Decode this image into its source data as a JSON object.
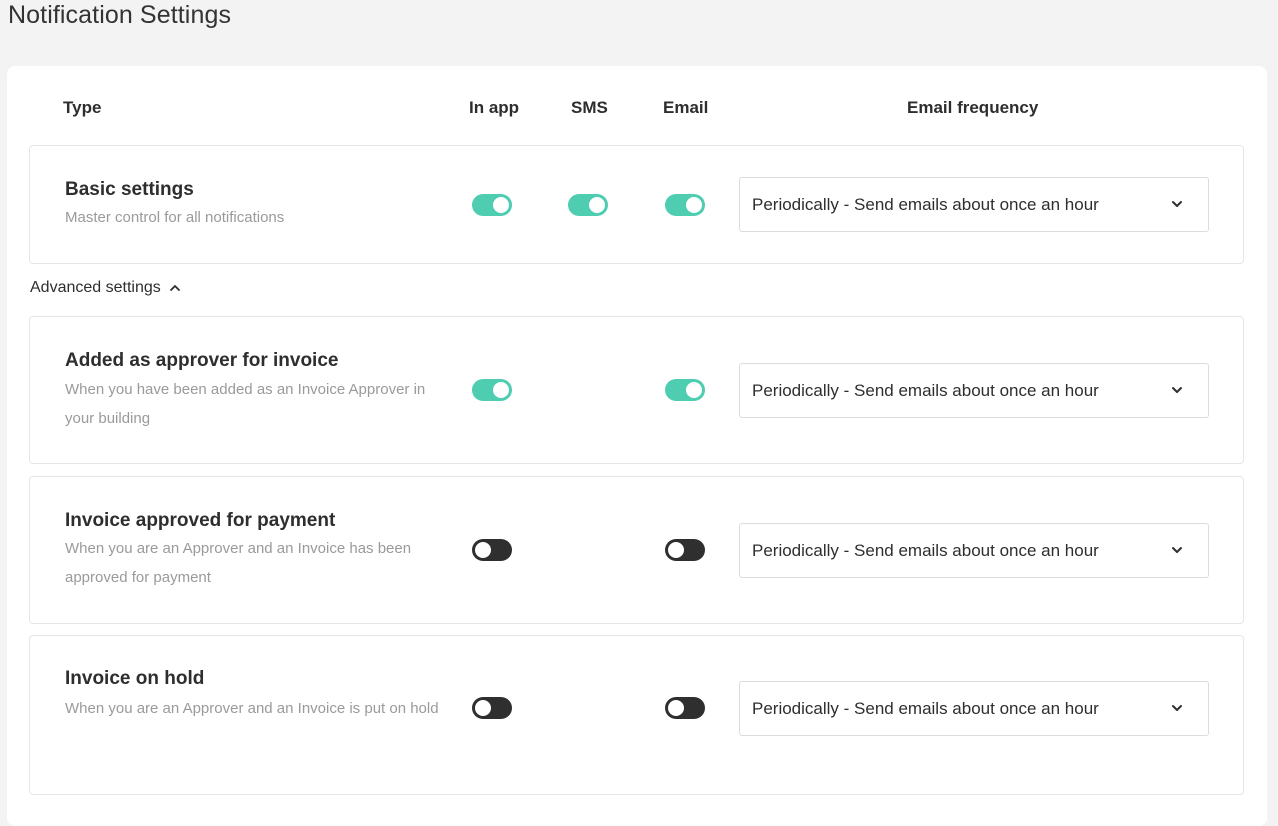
{
  "page": {
    "title": "Notification Settings"
  },
  "columns": {
    "type": "Type",
    "in_app": "In app",
    "sms": "SMS",
    "email": "Email",
    "email_frequency": "Email frequency"
  },
  "basic": {
    "title": "Basic settings",
    "description": "Master control for all notifications",
    "in_app": true,
    "sms": true,
    "email": true,
    "frequency": "Periodically - Send emails about once an hour"
  },
  "advanced_toggle": {
    "label": "Advanced settings",
    "icon": "chevron-up-icon",
    "expanded": true
  },
  "advanced_rows": [
    {
      "title": "Added as approver for invoice",
      "description": "When you have been added as an Invoice Approver in your building",
      "in_app": true,
      "email": true,
      "frequency": "Periodically - Send emails about once an hour"
    },
    {
      "title": "Invoice approved for payment",
      "description": "When you are an Approver and an Invoice has been approved for payment",
      "in_app": false,
      "email": false,
      "frequency": "Periodically - Send emails about once an hour"
    },
    {
      "title": "Invoice on hold",
      "description": "When you are an Approver and an Invoice is put on hold",
      "in_app": false,
      "email": false,
      "frequency": "Periodically - Send emails about once an hour"
    }
  ],
  "colors": {
    "toggle_on": "#4fcdb1",
    "toggle_off": "#2f2f2f"
  }
}
